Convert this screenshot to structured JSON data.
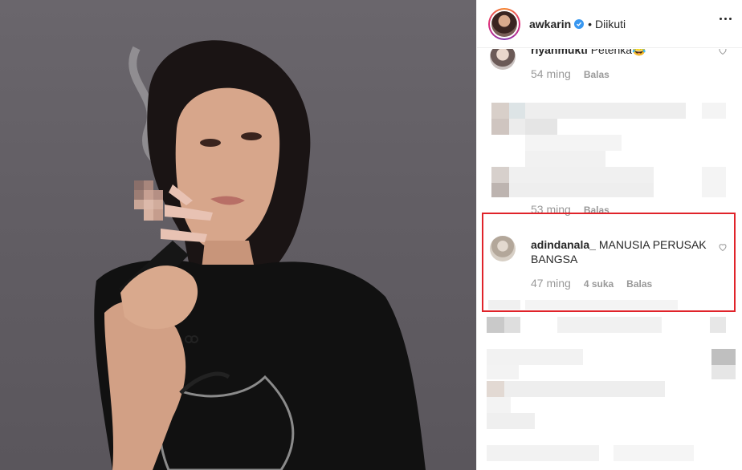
{
  "header": {
    "username": "awkarin",
    "separator": "•",
    "follow_status": "Diikuti",
    "icons": {
      "verified": "verified-badge-icon",
      "more": "more-options-icon"
    },
    "colors": {
      "verified": "#3897f0"
    }
  },
  "comments": [
    {
      "username": "riyanmukti",
      "text": "Petenka😂",
      "time": "54 ming",
      "likes": "",
      "reply_label": "Balas"
    },
    {
      "username": "",
      "text": "",
      "time": "53 ming",
      "likes": "",
      "reply_label": "Balas"
    },
    {
      "username": "adindanala_",
      "text": "MANUSIA PERUSAK BANGSA",
      "time": "47 ming",
      "likes": "4 suka",
      "reply_label": "Balas"
    }
  ],
  "highlight": {
    "color": "#e0232a"
  },
  "photo": {
    "subject": "woman in black t-shirt holding a vape device",
    "redacted": true
  }
}
